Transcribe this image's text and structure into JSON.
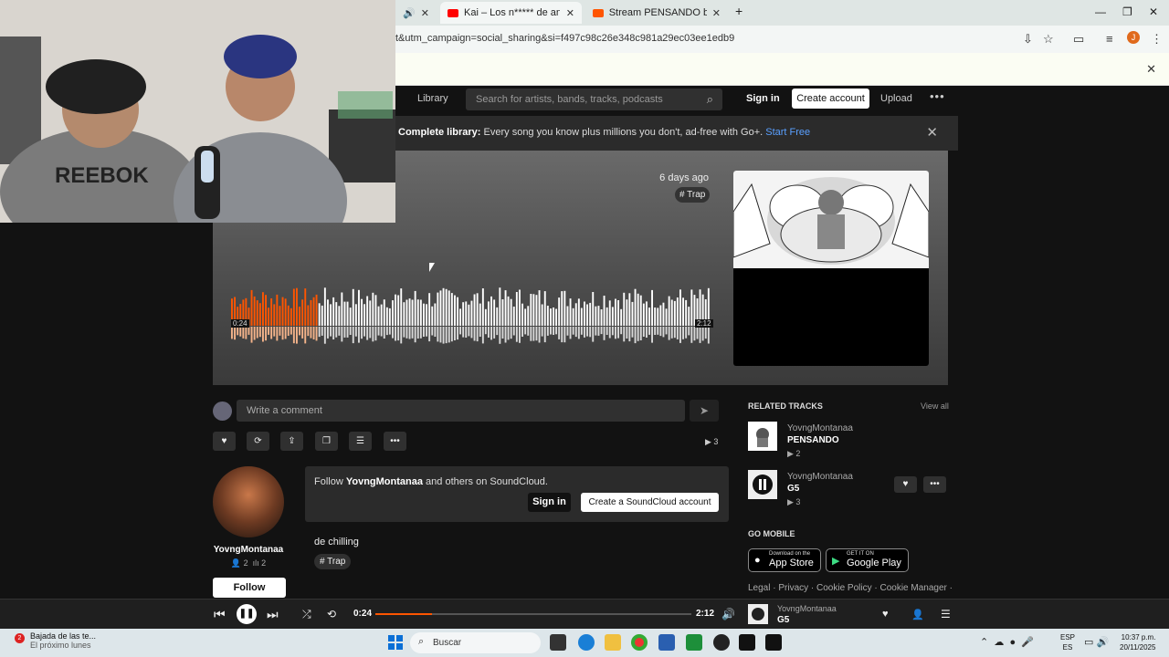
{
  "browser": {
    "tabs": [
      {
        "title": "Kai – Los n***** de antes (feat.",
        "icon_color": "#ff0000"
      },
      {
        "title": "Stream PENSANDO by YovngM",
        "icon_color": "#ff5500"
      }
    ],
    "new_tab_icon": "+",
    "url": "t&utm_campaign=social_sharing&si=f497c98c26e348c981a29ec03ee1edb9",
    "profile_initial": "J"
  },
  "header": {
    "library": "Library",
    "search_placeholder": "Search for artists, bands, tracks, podcasts",
    "sign_in": "Sign in",
    "create_account": "Create account",
    "upload": "Upload",
    "more": "•••"
  },
  "banner": {
    "bold": "Complete library:",
    "text": " Every song you know plus millions you don't, ad-free with Go+. ",
    "link": "Start Free"
  },
  "hero": {
    "date": "6 days ago",
    "tag": "# Trap",
    "time_elapsed": "0:24",
    "time_total": "2:12",
    "progress": 0.18
  },
  "comment": {
    "placeholder": "Write a comment"
  },
  "actions": {
    "plays": "3"
  },
  "artist": {
    "name": "YovngMontanaa",
    "followers": "2",
    "tracks": "2",
    "follow": "Follow"
  },
  "follow_box": {
    "pre": "Follow ",
    "name": "YovngMontanaa",
    "post": " and others on SoundCloud.",
    "sign_in": "Sign in",
    "create": "Create a SoundCloud account"
  },
  "description": {
    "text": "de chilling",
    "tag": "# Trap"
  },
  "related": {
    "heading": "RELATED TRACKS",
    "view_all": "View all",
    "tracks": [
      {
        "user": "YovngMontanaa",
        "title": "PENSANDO",
        "plays": "2"
      },
      {
        "user": "YovngMontanaa",
        "title": "G5",
        "plays": "3"
      }
    ]
  },
  "go_mobile": {
    "heading": "GO MOBILE",
    "app_store_small": "Download on the",
    "app_store": "App Store",
    "google_small": "GET IT ON",
    "google": "Google Play"
  },
  "legal": "Legal · Privacy · Cookie Policy · Cookie Manager ·",
  "player": {
    "time_elapsed": "0:24",
    "time_total": "2:12",
    "progress": 0.18,
    "user": "YovngMontanaa",
    "title": "G5"
  },
  "taskbar": {
    "weather_title": "Bajada de las te...",
    "weather_sub": "El próximo lunes",
    "weather_badge": "2",
    "search": "Buscar",
    "lang1": "ESP",
    "lang2": "ES",
    "time": "10:37 p.m.",
    "date": "20/11/2025"
  },
  "colors": {
    "accent": "#ff5500",
    "link": "#5aa0ff"
  }
}
